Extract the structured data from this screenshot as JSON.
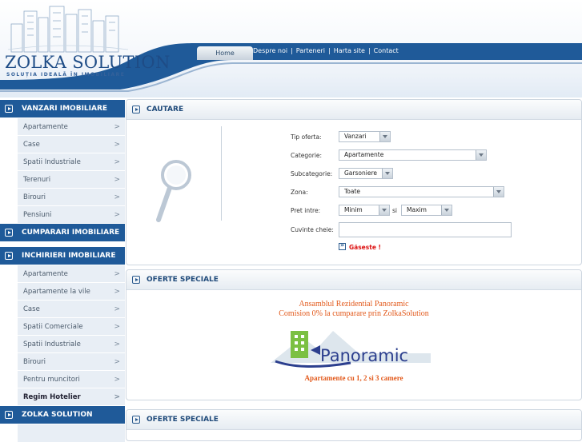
{
  "logo": {
    "title": "ZOLKA SOLUTION",
    "tagline": "SOLUȚIA IDEALĂ ÎN IMOBILIARE"
  },
  "nav": {
    "home": "Home",
    "links": [
      "Despre noi",
      "Parteneri",
      "Harta site",
      "Contact"
    ],
    "separator": "|"
  },
  "sidebar": {
    "sec1": "VANZARI IMOBILIARE",
    "vanzari": [
      "Apartamente",
      "Case",
      "Spatii Industriale",
      "Terenuri",
      "Birouri",
      "Pensiuni"
    ],
    "sec2": "CUMPARARI IMOBILIARE",
    "sec3": "INCHIRIERI IMOBILIARE",
    "inchirieri": [
      "Apartamente",
      "Apartamente la vile",
      "Case",
      "Spatii Comerciale",
      "Spatii Industriale",
      "Birouri",
      "Pentru muncitori",
      "Regim Hotelier"
    ],
    "sec4": "ZOLKA SOLUTION",
    "chevron": ">"
  },
  "search": {
    "title": "CAUTARE",
    "tip_label": "Tip oferta:",
    "tip_value": "Vanzari",
    "cat_label": "Categorie:",
    "cat_value": "Apartamente",
    "subcat_label": "Subcategorie:",
    "subcat_value": "Garsoniere",
    "zona_label": "Zona:",
    "zona_value": "Toate",
    "pret_label": "Pret intre:",
    "pret_min": "Minim",
    "si": "si",
    "pret_max": "Maxim",
    "kw_label": "Cuvinte cheie:",
    "go": "Găseste !"
  },
  "offers": {
    "title1": "OFERTE SPECIALE",
    "promo1": "Ansamblul Rezidential Panoramic",
    "promo2": "Comision 0% la cumparare prin ZolkaSolution",
    "panoramic": "Panoramic",
    "promo_sub": "Apartamente cu 1, 2 si 3 camere",
    "title2": "OFERTE SPECIALE"
  },
  "colors": {
    "primary": "#1f5a99",
    "accent": "#e2591b",
    "submenu": "#e8eef5"
  }
}
